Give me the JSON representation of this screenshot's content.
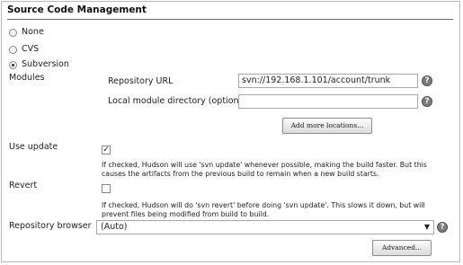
{
  "section": {
    "title": "Source Code Management"
  },
  "scm_options": [
    {
      "label": "None",
      "checked": false
    },
    {
      "label": "CVS",
      "checked": false
    },
    {
      "label": "Subversion",
      "checked": true
    }
  ],
  "modules": {
    "label": "Modules",
    "repository_url_label": "Repository URL",
    "repository_url_value": "svn://192.168.1.101/account/trunk",
    "local_dir_label": "Local module directory (optional)",
    "local_dir_value": "",
    "add_locations_button": "Add more locations..."
  },
  "use_update": {
    "label": "Use update",
    "checked": true,
    "description_line1": "If checked, Hudson will use 'svn update' whenever possible, making the build faster. But this",
    "description_line2": "causes the artifacts from the previous build to remain when a new build starts."
  },
  "revert": {
    "label": "Revert",
    "checked": false,
    "description_line1": "If checked, Hudson will do 'svn revert' before doing 'svn update'. This slows it down, but will",
    "description_line2": "prevent files being modified from build to build."
  },
  "repository_browser": {
    "label": "Repository browser",
    "selected": "(Auto)"
  },
  "advanced_button": "Advanced...",
  "help_glyph": "?",
  "check_glyph": "✓",
  "caret_glyph": "▼"
}
